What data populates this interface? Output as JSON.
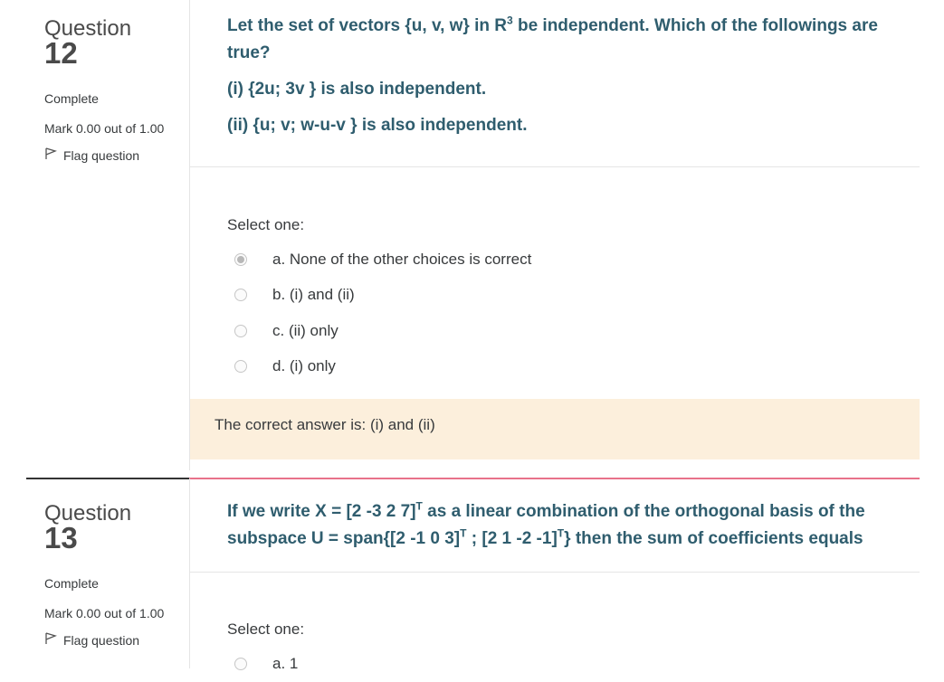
{
  "q12": {
    "word": "Question",
    "number": "12",
    "state": "Complete",
    "grade": "Mark 0.00 out of 1.00",
    "flag": "Flag question",
    "text_line1_pre": "Let the set of vectors {u, v, w} in R",
    "text_line1_sup": "3",
    "text_line1_post": " be independent. Which of the followings are true?",
    "text_item1": "(i) {2u; 3v } is also independent.",
    "text_item2": "(ii) {u; v; w-u-v } is also independent.",
    "prompt": "Select one:",
    "options": [
      {
        "label": "a. None of the other choices is correct",
        "checked": true
      },
      {
        "label": "b. (i) and (ii)",
        "checked": false
      },
      {
        "label": "c. (ii) only",
        "checked": false
      },
      {
        "label": "d. (i) only",
        "checked": false
      }
    ],
    "feedback": "The correct answer is: (i) and (ii)"
  },
  "q13": {
    "word": "Question",
    "number": "13",
    "state": "Complete",
    "grade": "Mark 0.00 out of 1.00",
    "flag": "Flag question",
    "text_a": "If we write X = [2 -3 2 7]",
    "sup_T": "T",
    "text_b": " as a linear combination of the orthogonal basis of the subspace U = span{[2 -1 0 3]",
    "text_c": " ; [2 1 -2 -1]",
    "text_d": "} then the sum of coefficients equals",
    "prompt": "Select one:",
    "first_option": "a. 1"
  },
  "colors": {
    "question_text": "#2f5d6e",
    "feedback_bg": "#fcefdc",
    "divider_accent": "#e8728a"
  }
}
